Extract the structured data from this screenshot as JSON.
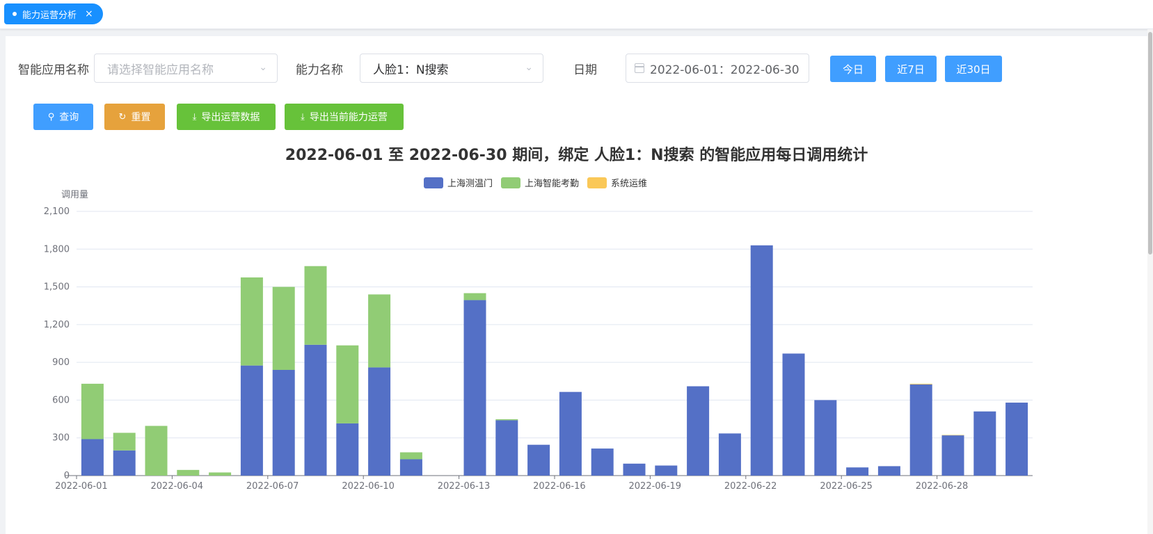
{
  "tab": {
    "label": "能力运营分析",
    "close": "×"
  },
  "filters": {
    "app_label": "智能应用名称",
    "app_placeholder": "请选择智能应用名称",
    "ability_label": "能力名称",
    "ability_value": "人脸1：N搜索",
    "date_label": "日期",
    "date_value": "2022-06-01：2022-06-30"
  },
  "quick_buttons": {
    "today": "今日",
    "last7": "近7日",
    "last30": "近30日"
  },
  "actions": {
    "query": "查询",
    "reset": "重置",
    "export_ops": "导出运营数据",
    "export_current": "导出当前能力运营"
  },
  "colors": {
    "primary": "#409eff",
    "tab": "#1890ff",
    "reset": "#e6a23c",
    "export": "#67c23a"
  },
  "chart_data": {
    "type": "bar",
    "stacked": true,
    "title": "2022-06-01 至 2022-06-30 期间，绑定 人脸1：N搜索 的智能应用每日调用统计",
    "ylabel": "调用量",
    "ylim": [
      0,
      2100
    ],
    "yticks": [
      0,
      300,
      600,
      900,
      1200,
      1500,
      1800,
      2100
    ],
    "ytick_labels": [
      "0",
      "300",
      "600",
      "900",
      "1,200",
      "1,500",
      "1,800",
      "2,100"
    ],
    "xtick_labels": [
      "2022-06-01",
      "2022-06-04",
      "2022-06-07",
      "2022-06-10",
      "2022-06-13",
      "2022-06-16",
      "2022-06-19",
      "2022-06-22",
      "2022-06-25",
      "2022-06-28"
    ],
    "categories": [
      "2022-06-01",
      "2022-06-02",
      "2022-06-03",
      "2022-06-04",
      "2022-06-05",
      "2022-06-06",
      "2022-06-07",
      "2022-06-08",
      "2022-06-09",
      "2022-06-10",
      "2022-06-11",
      "2022-06-12",
      "2022-06-13",
      "2022-06-14",
      "2022-06-15",
      "2022-06-16",
      "2022-06-17",
      "2022-06-18",
      "2022-06-19",
      "2022-06-20",
      "2022-06-21",
      "2022-06-22",
      "2022-06-23",
      "2022-06-24",
      "2022-06-25",
      "2022-06-26",
      "2022-06-27",
      "2022-06-28",
      "2022-06-29",
      "2022-06-30"
    ],
    "series": [
      {
        "name": "上海测温门",
        "color": "#5470c6",
        "values": [
          290,
          200,
          0,
          0,
          0,
          875,
          840,
          1040,
          415,
          860,
          130,
          0,
          1395,
          440,
          245,
          665,
          215,
          95,
          80,
          710,
          335,
          1830,
          970,
          600,
          65,
          75,
          725,
          320,
          510,
          580
        ]
      },
      {
        "name": "上海智能考勤",
        "color": "#91cc75",
        "values": [
          440,
          140,
          395,
          45,
          25,
          700,
          660,
          625,
          620,
          580,
          55,
          0,
          55,
          8,
          0,
          0,
          0,
          0,
          0,
          0,
          0,
          0,
          0,
          0,
          0,
          0,
          0,
          0,
          0,
          0
        ]
      },
      {
        "name": "系统运维",
        "color": "#fac858",
        "values": [
          0,
          0,
          0,
          0,
          0,
          0,
          0,
          0,
          0,
          0,
          0,
          0,
          0,
          0,
          0,
          0,
          0,
          0,
          0,
          0,
          0,
          0,
          0,
          0,
          0,
          0,
          5,
          3,
          0,
          0
        ]
      }
    ],
    "grid": true,
    "legend_position": "top-center"
  }
}
